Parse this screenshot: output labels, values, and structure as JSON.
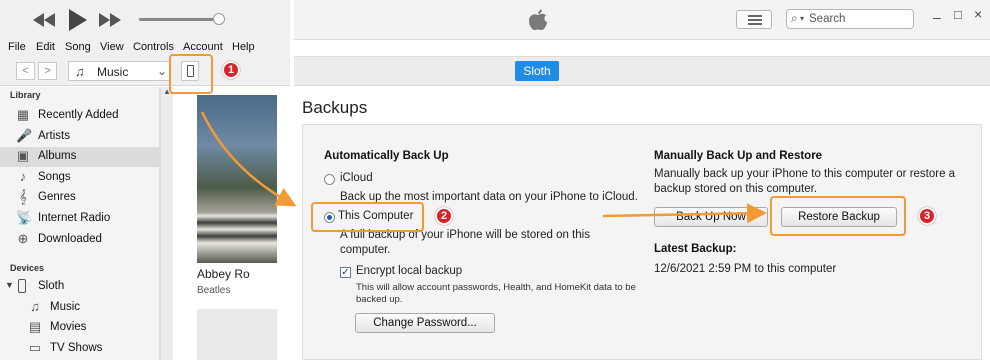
{
  "menubar": {
    "items": [
      "File",
      "Edit",
      "Song",
      "View",
      "Controls",
      "Account",
      "Help"
    ]
  },
  "library_picker": {
    "value": "Music"
  },
  "sidebar": {
    "library_heading": "Library",
    "library_items": [
      {
        "label": "Recently Added",
        "icon": "recently-added-icon"
      },
      {
        "label": "Artists",
        "icon": "artists-icon"
      },
      {
        "label": "Albums",
        "icon": "albums-icon",
        "selected": true
      },
      {
        "label": "Songs",
        "icon": "songs-icon"
      },
      {
        "label": "Genres",
        "icon": "genres-icon"
      },
      {
        "label": "Internet Radio",
        "icon": "internet-radio-icon"
      },
      {
        "label": "Downloaded",
        "icon": "downloaded-icon"
      }
    ],
    "devices_heading": "Devices",
    "device_name": "Sloth",
    "device_items": [
      {
        "label": "Music",
        "icon": "music-icon"
      },
      {
        "label": "Movies",
        "icon": "movies-icon"
      },
      {
        "label": "TV Shows",
        "icon": "tv-shows-icon"
      }
    ]
  },
  "album": {
    "title": "Abbey Ro",
    "artist": "Beatles"
  },
  "search": {
    "placeholder": "Search"
  },
  "device_tab": "Sloth",
  "backups": {
    "title": "Backups",
    "auto_heading": "Automatically Back Up",
    "icloud_label": "iCloud",
    "icloud_desc": "Back up the most important data on your iPhone to iCloud.",
    "computer_label": "This Computer",
    "computer_desc_1": "A full backup of your iPhone will be stored on this",
    "computer_desc_2": "computer.",
    "encrypt_label": "Encrypt local backup",
    "encrypt_desc_1": "This will allow account passwords, Health, and HomeKit data to be",
    "encrypt_desc_2": "backed up.",
    "change_password": "Change Password...",
    "manual_heading": "Manually Back Up and Restore",
    "manual_desc_1": "Manually back up your iPhone to this computer or restore a",
    "manual_desc_2": "backup stored on this computer.",
    "back_up_now": "Back Up Now",
    "restore_backup": "Restore Backup",
    "latest_heading": "Latest Backup:",
    "latest_value": "12/6/2021 2:59 PM to this computer"
  },
  "annotations": {
    "step1": "1",
    "step2": "2",
    "step3": "3"
  },
  "colors": {
    "accent": "#1f8de6",
    "highlight": "#f39a36",
    "badge": "#d9232b"
  }
}
